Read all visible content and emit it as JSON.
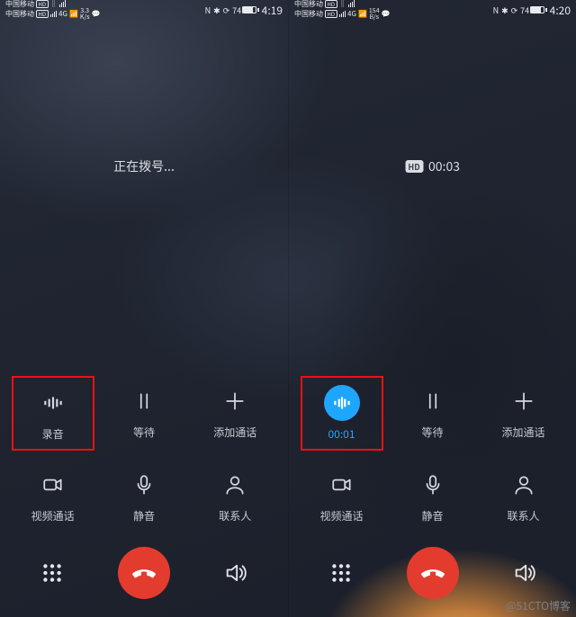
{
  "watermark": "@51CTO博客",
  "statusbar": {
    "carrier": "中国移动",
    "signal_type": "4G",
    "hd": "HD",
    "battery_pct": "74",
    "nfc": "N",
    "bt": "✱"
  },
  "left": {
    "time": "4:19",
    "speed_val": "3.3",
    "speed_unit": "K/s",
    "status": "正在拨号...",
    "controls": {
      "record": "录音",
      "hold": "等待",
      "add": "添加通话",
      "video": "视频通话",
      "mute": "静音",
      "contacts": "联系人"
    }
  },
  "right": {
    "time": "4:20",
    "speed_val": "154",
    "speed_unit": "B/s",
    "hd_badge": "HD",
    "status": "00:03",
    "controls": {
      "record": "00:01",
      "hold": "等待",
      "add": "添加通话",
      "video": "视频通话",
      "mute": "静音",
      "contacts": "联系人"
    }
  }
}
